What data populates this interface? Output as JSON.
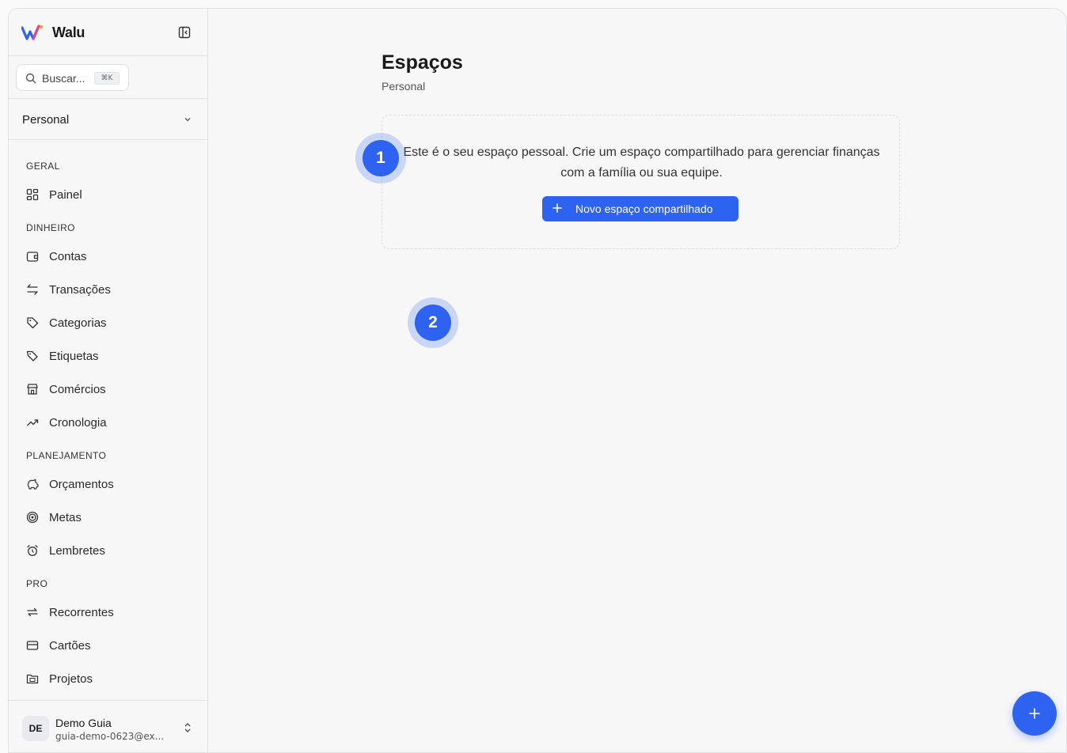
{
  "brand": {
    "name": "Walu",
    "logo_icon": "walu-logo-icon",
    "accent": "#2e62f0"
  },
  "search": {
    "placeholder": "Buscar...",
    "shortcut": "⌘K"
  },
  "workspace": {
    "selected": "Personal"
  },
  "sidebar": {
    "sections": [
      {
        "title": "GERAL",
        "items": [
          {
            "label": "Painel",
            "icon": "dashboard-icon"
          }
        ]
      },
      {
        "title": "DINHEIRO",
        "items": [
          {
            "label": "Contas",
            "icon": "wallet-icon"
          },
          {
            "label": "Transações",
            "icon": "arrows-left-right-icon"
          },
          {
            "label": "Categorias",
            "icon": "tag-icon"
          },
          {
            "label": "Etiquetas",
            "icon": "label-icon"
          },
          {
            "label": "Comércios",
            "icon": "store-icon"
          },
          {
            "label": "Cronologia",
            "icon": "trending-up-icon"
          }
        ]
      },
      {
        "title": "PLANEJAMENTO",
        "items": [
          {
            "label": "Orçamentos",
            "icon": "piggy-bank-icon"
          },
          {
            "label": "Metas",
            "icon": "target-icon"
          },
          {
            "label": "Lembretes",
            "icon": "alarm-clock-icon"
          }
        ]
      },
      {
        "title": "PRO",
        "items": [
          {
            "label": "Recorrentes",
            "icon": "repeat-icon"
          },
          {
            "label": "Cartões",
            "icon": "credit-card-icon"
          },
          {
            "label": "Projetos",
            "icon": "folder-icon"
          }
        ]
      }
    ]
  },
  "user": {
    "initials": "DE",
    "name": "Demo Guia",
    "email": "guia-demo-0623@ex..."
  },
  "main": {
    "title": "Espaços",
    "subtitle": "Personal",
    "empty_message": "Este é o seu espaço pessoal. Crie um espaço compartilhado para gerenciar finanças com a família ou sua equipe.",
    "new_button": "Novo espaço compartilhado"
  },
  "markers": [
    "1",
    "2"
  ],
  "fab": {
    "icon": "plus-icon"
  }
}
